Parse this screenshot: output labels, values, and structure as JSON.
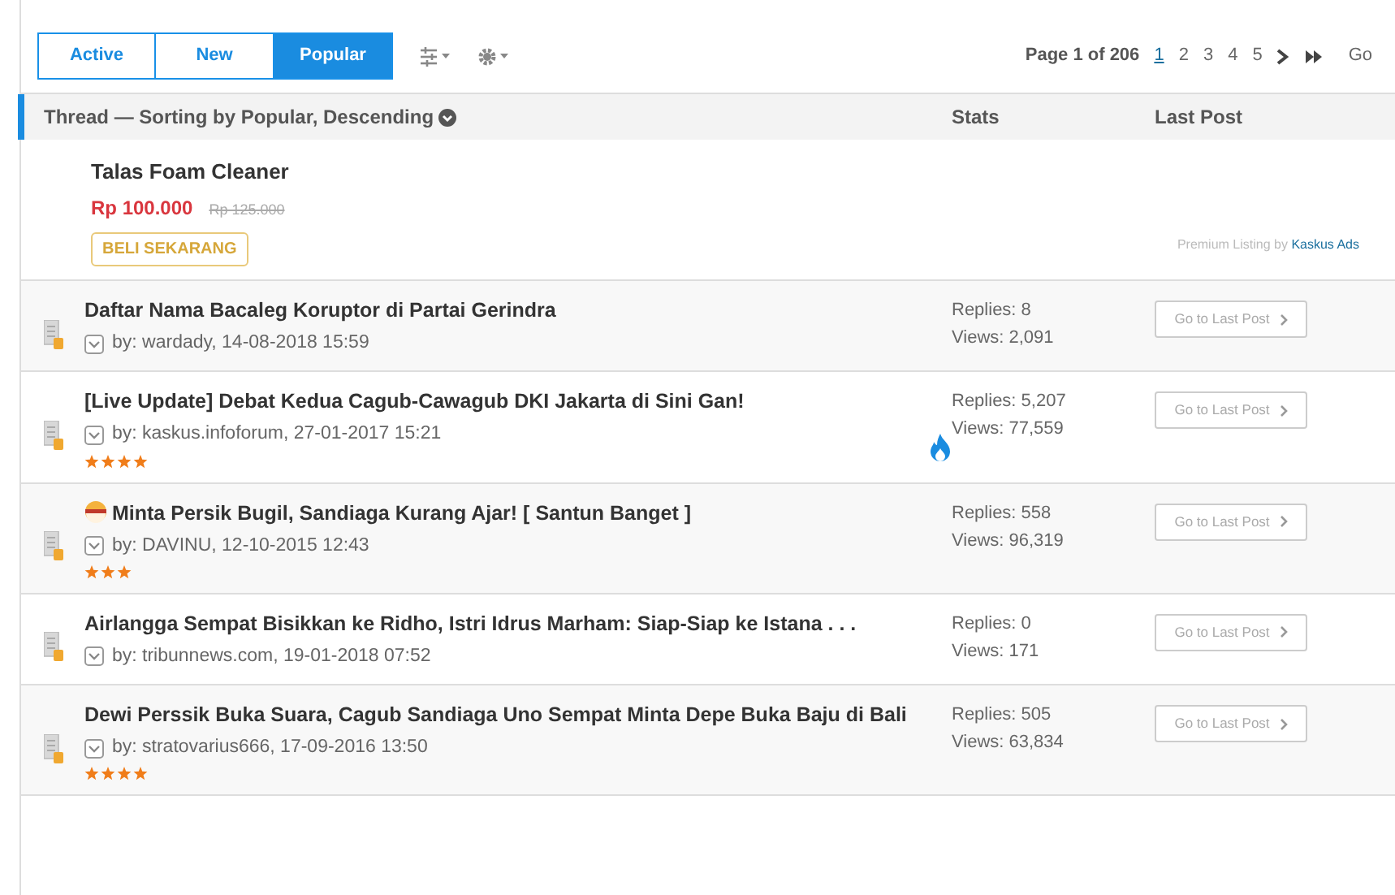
{
  "tabs": [
    {
      "label": "Active",
      "selected": false
    },
    {
      "label": "New",
      "selected": false
    },
    {
      "label": "Popular",
      "selected": true
    }
  ],
  "pagination": {
    "summary": "Page 1 of 206",
    "pages": [
      {
        "label": "1",
        "selected": true
      },
      {
        "label": "2",
        "selected": false
      },
      {
        "label": "3",
        "selected": false
      },
      {
        "label": "4",
        "selected": false
      },
      {
        "label": "5",
        "selected": false
      }
    ],
    "go": "Go"
  },
  "table": {
    "columns": [
      "Thread — Sorting by Popular, Descending",
      "Stats",
      "Last Post"
    ]
  },
  "ad": {
    "title": "Talas Foam Cleaner",
    "price": "Rp 100.000",
    "old_price": "Rp 125.000",
    "button": "BELI SEKARANG",
    "credit": "Premium Listing by",
    "credit_link": "Kaskus Ads"
  },
  "threads": [
    {
      "title": "Daftar Nama Bacaleg Koruptor di Partai Gerindra",
      "by": "by:",
      "meta": "wardady, 14-08-2018 15:59",
      "hot": false,
      "emoticon": false,
      "replies": "Replies: 8",
      "views": "Views: 2,091",
      "button": "Go to Last Post"
    },
    {
      "title": "[Live Update] Debat Kedua Cagub-Cawagub DKI Jakarta di Sini Gan!",
      "by": "by:",
      "meta": "kaskus.infoforum, 27-01-2017 15:21",
      "stars": 4,
      "hot": true,
      "emoticon": false,
      "replies": "Replies: 5,207",
      "views": "Views: 77,559",
      "button": "Go to Last Post"
    },
    {
      "title": "Minta Persik Bugil, Sandiaga Kurang Ajar! [ Santun Banget ]",
      "by": "by:",
      "meta": "DAVINU, 12-10-2015 12:43",
      "stars": 3,
      "hot": false,
      "emoticon": true,
      "replies": "Replies: 558",
      "views": "Views: 96,319",
      "button": "Go to Last Post"
    },
    {
      "title": "Airlangga Sempat Bisikkan ke Ridho, Istri Idrus Marham: Siap-Siap ke Istana . . .",
      "by": "by:",
      "meta": "tribunnews.com, 19-01-2018 07:52",
      "hot": false,
      "emoticon": false,
      "replies": "Replies: 0",
      "views": "Views: 171",
      "button": "Go to Last Post"
    },
    {
      "title": "Dewi Perssik Buka Suara, Cagub Sandiaga Uno Sempat Minta Depe Buka Baju di Bali",
      "by": "by:",
      "meta": "stratovarius666, 17-09-2016 13:50",
      "stars": 4,
      "hot": false,
      "emoticon": false,
      "replies": "Replies: 505",
      "views": "Views: 63,834",
      "button": "Go to Last Post"
    }
  ]
}
